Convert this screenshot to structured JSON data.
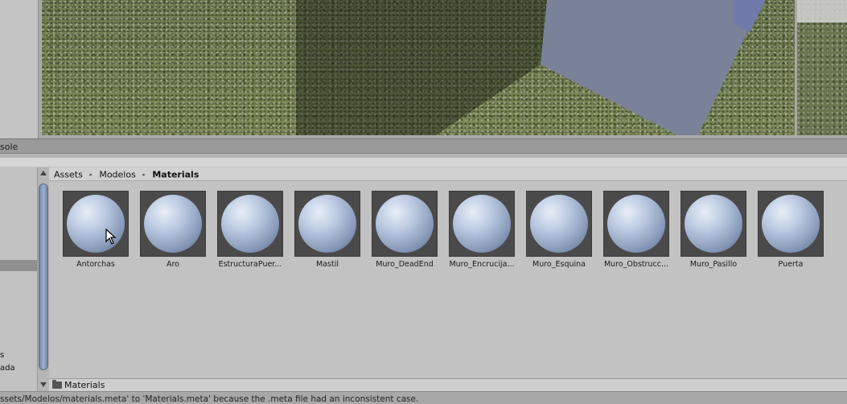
{
  "console_tab": {
    "label": "sole"
  },
  "breadcrumb": {
    "items": [
      "Assets",
      "Modelos",
      "Materials"
    ],
    "separator": "▸"
  },
  "assets": [
    {
      "name": "Antorchas"
    },
    {
      "name": "Aro"
    },
    {
      "name": "EstructuraPuer..."
    },
    {
      "name": "Mastil"
    },
    {
      "name": "Muro_DeadEnd"
    },
    {
      "name": "Muro_Encrucija..."
    },
    {
      "name": "Muro_Esquina"
    },
    {
      "name": "Muro_Obstrucc..."
    },
    {
      "name": "Muro_Pasillo"
    },
    {
      "name": "Puerta"
    }
  ],
  "tree": {
    "item_1": "s",
    "item_2": "ada"
  },
  "path_bar": {
    "label": "Materials",
    "icon": "folder-icon"
  },
  "status_bar": {
    "message": "ssets/Modelos/materials.meta' to 'Materials.meta' because the .meta file had an inconsistent case."
  },
  "colors": {
    "scroll_thumb": "#8797b8",
    "material_sphere": "#b9c8e0",
    "grass": "#6d7a4e"
  }
}
